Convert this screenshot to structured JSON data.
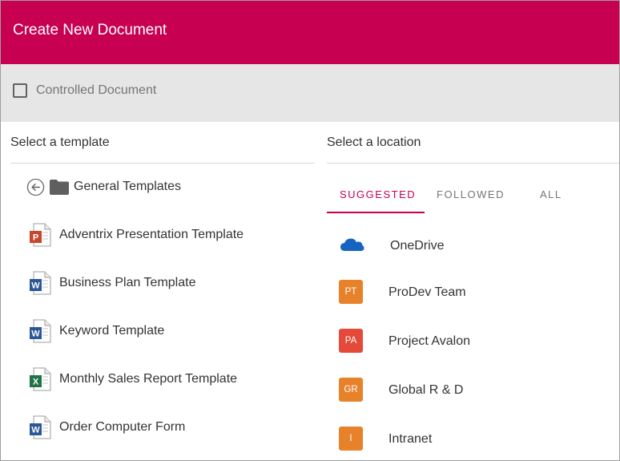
{
  "dialog": {
    "title": "Create New Document",
    "header_color": "#c70052",
    "controlled_document": {
      "label": "Controlled Document",
      "checked": false
    }
  },
  "templates": {
    "section_label": "Select a template",
    "folder": {
      "name": "General Templates",
      "back_icon": "back-arrow-icon",
      "folder_icon": "folder-icon"
    },
    "items": [
      {
        "label": "Adventrix Presentation Template",
        "icon": "powerpoint-file-icon"
      },
      {
        "label": "Business Plan Template",
        "icon": "word-file-icon"
      },
      {
        "label": "Keyword Template",
        "icon": "word-file-icon"
      },
      {
        "label": "Monthly Sales Report Template",
        "icon": "excel-file-icon"
      },
      {
        "label": "Order Computer Form",
        "icon": "word-file-icon"
      }
    ]
  },
  "locations": {
    "section_label": "Select a location",
    "tabs": [
      {
        "label": "SUGGESTED",
        "active": true
      },
      {
        "label": "FOLLOWED",
        "active": false
      },
      {
        "label": "ALL",
        "active": false
      }
    ],
    "items": [
      {
        "label": "OneDrive",
        "icon": "onedrive-cloud-icon",
        "badge": "",
        "color": "#1565c0"
      },
      {
        "label": "ProDev Team",
        "icon": "site-badge-icon",
        "badge": "PT",
        "color": "#e8822a"
      },
      {
        "label": "Project Avalon",
        "icon": "site-badge-icon",
        "badge": "PA",
        "color": "#e5493a"
      },
      {
        "label": "Global R & D",
        "icon": "site-badge-icon",
        "badge": "GR",
        "color": "#e8822a"
      },
      {
        "label": "Intranet",
        "icon": "site-badge-icon",
        "badge": "I",
        "color": "#e8822a"
      }
    ]
  }
}
